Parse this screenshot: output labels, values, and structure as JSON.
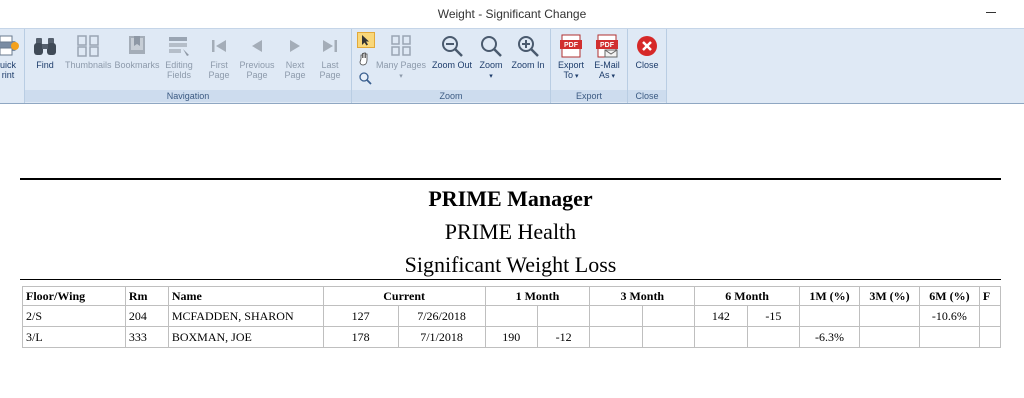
{
  "window": {
    "title": "Weight - Significant Change"
  },
  "ribbon": {
    "quick_print": {
      "label_top": "uick",
      "label_bottom": "rint",
      "icon": "printer-icon"
    },
    "find": {
      "label": "Find",
      "icon": "binoculars-icon"
    },
    "thumbnails": {
      "label": "Thumbnails",
      "icon": "thumbnails-icon"
    },
    "bookmarks": {
      "label": "Bookmarks",
      "icon": "bookmark-icon"
    },
    "editing_fields": {
      "label_top": "Editing",
      "label_bottom": "Fields",
      "icon": "edit-fields-icon"
    },
    "first_page": {
      "label_top": "First",
      "label_bottom": "Page",
      "icon": "first-page-icon"
    },
    "previous_page": {
      "label_top": "Previous",
      "label_bottom": "Page",
      "icon": "previous-page-icon"
    },
    "next_page": {
      "label_top": "Next",
      "label_bottom": "Page",
      "icon": "next-page-icon"
    },
    "last_page": {
      "label_top": "Last",
      "label_bottom": "Page",
      "icon": "last-page-icon"
    },
    "navigation_group": "Navigation",
    "many_pages": {
      "label": "Many Pages",
      "icon": "many-pages-icon"
    },
    "zoom_out": {
      "label": "Zoom Out",
      "icon": "zoom-out-icon"
    },
    "zoom": {
      "label": "Zoom",
      "icon": "zoom-icon"
    },
    "zoom_in": {
      "label": "Zoom In",
      "icon": "zoom-in-icon"
    },
    "zoom_group": "Zoom",
    "export_to": {
      "label_top": "Export",
      "label_bottom": "To",
      "icon": "pdf-export-icon"
    },
    "email_as": {
      "label_top": "E-Mail",
      "label_bottom": "As",
      "icon": "pdf-email-icon"
    },
    "export_group": "Export",
    "close": {
      "label": "Close",
      "icon": "close-circle-icon"
    },
    "close_group": "Close"
  },
  "report": {
    "title": "PRIME Manager",
    "subtitle": "PRIME Health",
    "report_name": "Significant Weight Loss",
    "headers": {
      "floor_wing": "Floor/Wing",
      "rm": "Rm",
      "name": "Name",
      "current": "Current",
      "one_month": "1 Month",
      "three_month": "3 Month",
      "six_month": "6 Month",
      "pct_1m": "1M (%)",
      "pct_3m": "3M (%)",
      "pct_6m": "6M (%)",
      "f": "F"
    },
    "rows": [
      {
        "floor_wing": "2/S",
        "rm": "204",
        "name": "MCFADDEN, SHARON",
        "current_wt": "127",
        "current_date": "7/26/2018",
        "m1_wt": "",
        "m1_chg": "",
        "m3_wt": "",
        "m3_chg": "",
        "m6_wt": "142",
        "m6_chg": "-15",
        "pct_1m": "",
        "pct_3m": "",
        "pct_6m": "-10.6%",
        "f": ""
      },
      {
        "floor_wing": "3/L",
        "rm": "333",
        "name": "BOXMAN, JOE",
        "current_wt": "178",
        "current_date": "7/1/2018",
        "m1_wt": "190",
        "m1_chg": "-12",
        "m3_wt": "",
        "m3_chg": "",
        "m6_wt": "",
        "m6_chg": "",
        "pct_1m": "-6.3%",
        "pct_3m": "",
        "pct_6m": "",
        "f": ""
      }
    ]
  }
}
